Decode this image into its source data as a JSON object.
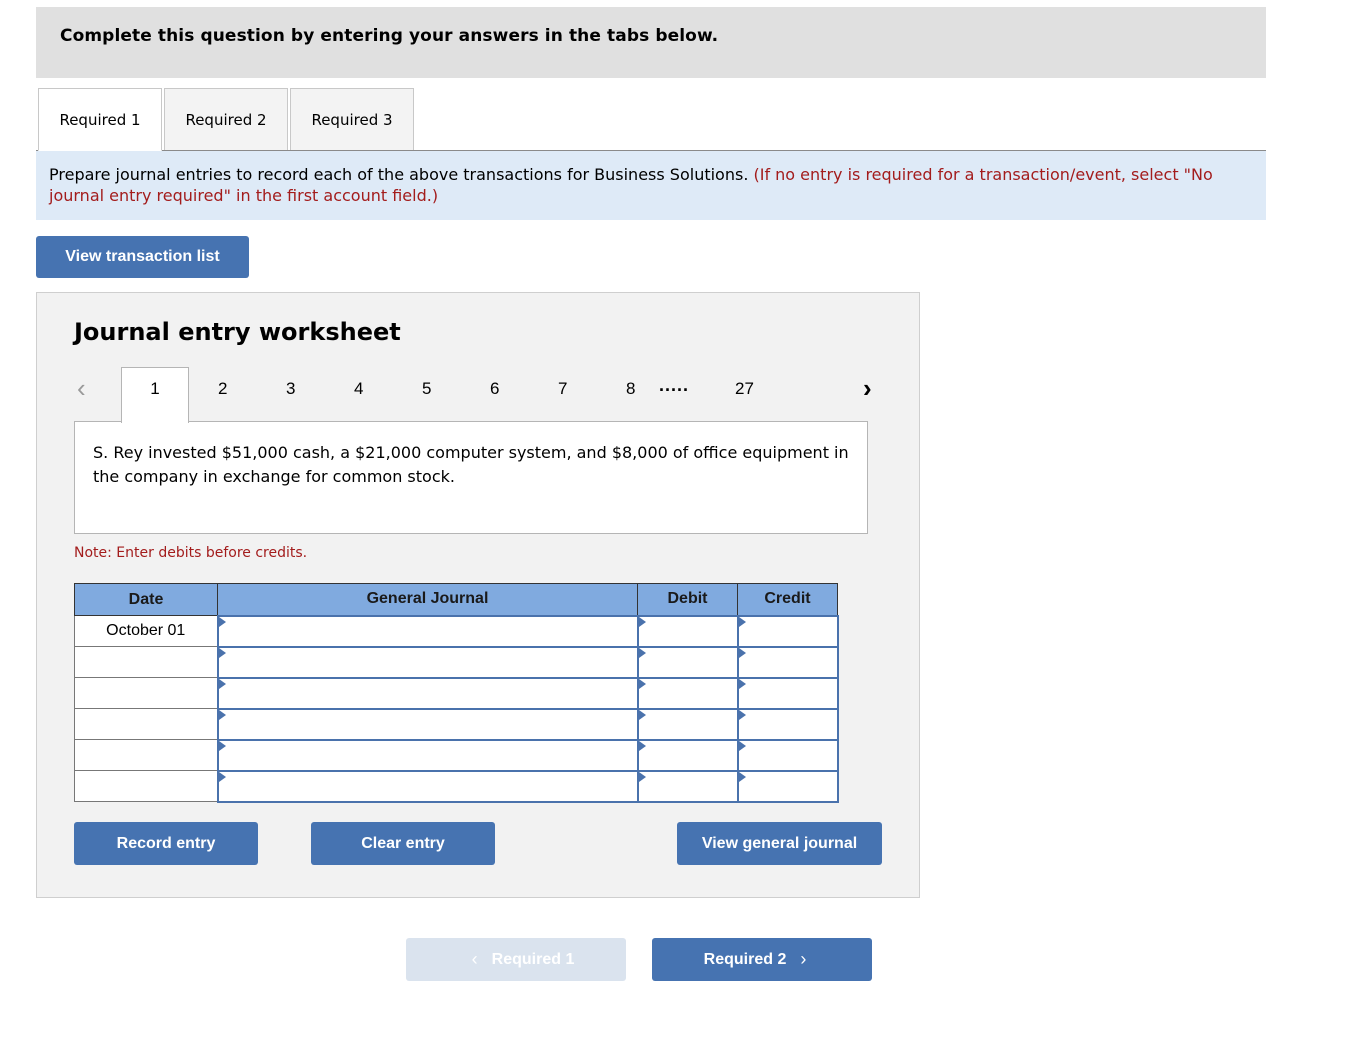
{
  "banner": {
    "text": "Complete this question by entering your answers in the tabs below."
  },
  "tabs": [
    {
      "label": "Required 1",
      "active": true
    },
    {
      "label": "Required 2",
      "active": false
    },
    {
      "label": "Required 3",
      "active": false
    }
  ],
  "instructions": {
    "text": "Prepare journal entries to record each of the above transactions for Business Solutions. ",
    "note": "(If no entry is required for a transaction/event, select \"No journal entry required\" in the first account field.)"
  },
  "view_transaction_list": "View transaction list",
  "worksheet": {
    "title": "Journal entry worksheet",
    "pager": {
      "prev_icon": "‹",
      "next_icon": "›",
      "pages": [
        "1",
        "2",
        "3",
        "4",
        "5",
        "6",
        "7",
        "8"
      ],
      "ellipsis": ".....",
      "last": "27",
      "current": "1"
    },
    "transaction_text": "S. Rey invested $51,000 cash, a $21,000 computer system, and $8,000 of office equipment in the company in exchange for common stock.",
    "note": "Note: Enter debits before credits.",
    "table": {
      "headers": [
        "Date",
        "General Journal",
        "Debit",
        "Credit"
      ],
      "rows": [
        {
          "date": "October 01",
          "account": "",
          "debit": "",
          "credit": ""
        },
        {
          "date": "",
          "account": "",
          "debit": "",
          "credit": ""
        },
        {
          "date": "",
          "account": "",
          "debit": "",
          "credit": ""
        },
        {
          "date": "",
          "account": "",
          "debit": "",
          "credit": ""
        },
        {
          "date": "",
          "account": "",
          "debit": "",
          "credit": ""
        },
        {
          "date": "",
          "account": "",
          "debit": "",
          "credit": ""
        }
      ]
    },
    "buttons": {
      "record": "Record entry",
      "clear": "Clear entry",
      "view_general_journal": "View general journal"
    }
  },
  "navigation": {
    "prev_label": "Required 1",
    "next_label": "Required 2",
    "prev_icon": "‹",
    "next_icon": "›"
  },
  "colors": {
    "button_blue": "#4673b1",
    "header_blue": "#80aadf",
    "instruction_bg": "#deeaf7",
    "note_red": "#a31c1c"
  }
}
